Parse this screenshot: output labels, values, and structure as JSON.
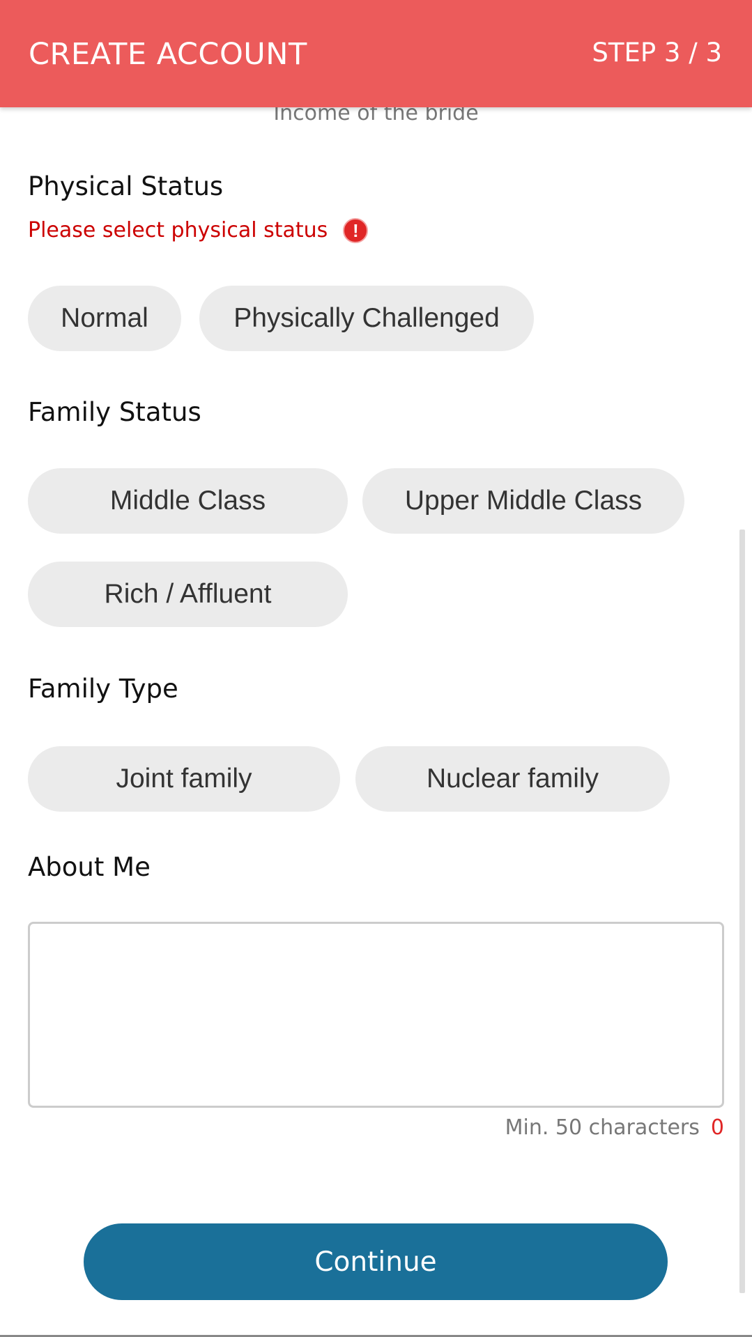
{
  "header": {
    "title": "CREATE ACCOUNT",
    "step": "STEP 3 / 3",
    "background_color": "#ec5b5b"
  },
  "previous_field_hint": "Income of the bride",
  "physical_status": {
    "title": "Physical Status",
    "error": "Please select physical status",
    "error_icon": "exclamation-circle-icon",
    "options": [
      "Normal",
      "Physically Challenged"
    ]
  },
  "family_status": {
    "title": "Family Status",
    "options": [
      "Middle Class",
      "Upper Middle Class",
      "Rich / Affluent"
    ]
  },
  "family_type": {
    "title": "Family Type",
    "options": [
      "Joint family",
      "Nuclear family"
    ]
  },
  "about_me": {
    "title": "About Me",
    "value": "",
    "min_label": "Min. 50 characters",
    "count": "0"
  },
  "continue_label": "Continue",
  "colors": {
    "accent": "#ec5b5b",
    "primary_button": "#1a7099",
    "error": "#cc0000",
    "chip_background": "#ebebeb"
  }
}
